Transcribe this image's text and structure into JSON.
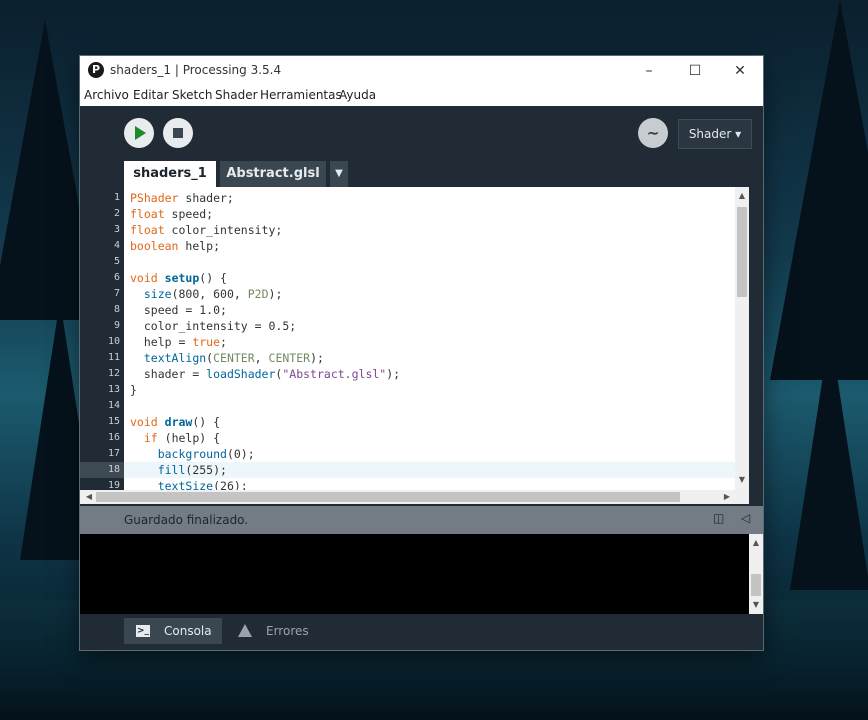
{
  "window": {
    "title": "shaders_1 | Processing 3.5.4",
    "logo_icon": "processing-logo-icon",
    "controls": [
      "minimize-icon",
      "maximize-icon",
      "close-icon"
    ]
  },
  "menu": [
    "Archivo",
    "Editar",
    "Sketch",
    "Shader",
    "Herramientas",
    "Ayuda"
  ],
  "toolbar": {
    "run_icon": "play-icon",
    "stop_icon": "stop-icon",
    "debug_icon": "butterfly-icon",
    "mode": "Shader ▾"
  },
  "tabs": [
    "shaders_1",
    "Abstract.glsl"
  ],
  "tab_menu_glyph": "▼",
  "editor": {
    "line_numbers": [
      "1",
      "2",
      "3",
      "4",
      "5",
      "6",
      "7",
      "8",
      "9",
      "10",
      "11",
      "12",
      "13",
      "14",
      "15",
      "16",
      "17",
      "18",
      "19"
    ],
    "highlighted_line": "18",
    "lines": [
      [
        {
          "t": "PShader",
          "c": "kw"
        },
        {
          "t": " shader;",
          "c": ""
        }
      ],
      [
        {
          "t": "float",
          "c": "kw"
        },
        {
          "t": " speed;",
          "c": ""
        }
      ],
      [
        {
          "t": "float",
          "c": "kw"
        },
        {
          "t": " color_intensity;",
          "c": ""
        }
      ],
      [
        {
          "t": "boolean",
          "c": "kw"
        },
        {
          "t": " help;",
          "c": ""
        }
      ],
      [],
      [
        {
          "t": "void",
          "c": "kw"
        },
        {
          "t": " ",
          "c": ""
        },
        {
          "t": "setup",
          "c": "fnb"
        },
        {
          "t": "() {",
          "c": ""
        }
      ],
      [
        {
          "t": "  ",
          "c": ""
        },
        {
          "t": "size",
          "c": "fn"
        },
        {
          "t": "(800, 600, ",
          "c": ""
        },
        {
          "t": "P2D",
          "c": "cst"
        },
        {
          "t": ");",
          "c": ""
        }
      ],
      [
        {
          "t": "  speed = 1.0;",
          "c": ""
        }
      ],
      [
        {
          "t": "  color_intensity = 0.5;",
          "c": ""
        }
      ],
      [
        {
          "t": "  help = ",
          "c": ""
        },
        {
          "t": "true",
          "c": "kw"
        },
        {
          "t": ";",
          "c": ""
        }
      ],
      [
        {
          "t": "  ",
          "c": ""
        },
        {
          "t": "textAlign",
          "c": "fn"
        },
        {
          "t": "(",
          "c": ""
        },
        {
          "t": "CENTER",
          "c": "cst"
        },
        {
          "t": ", ",
          "c": ""
        },
        {
          "t": "CENTER",
          "c": "cst"
        },
        {
          "t": ");",
          "c": ""
        }
      ],
      [
        {
          "t": "  shader = ",
          "c": ""
        },
        {
          "t": "loadShader",
          "c": "fn"
        },
        {
          "t": "(",
          "c": ""
        },
        {
          "t": "\"Abstract.glsl\"",
          "c": "str"
        },
        {
          "t": ");",
          "c": ""
        }
      ],
      [
        {
          "t": "}",
          "c": ""
        }
      ],
      [],
      [
        {
          "t": "void",
          "c": "kw"
        },
        {
          "t": " ",
          "c": ""
        },
        {
          "t": "draw",
          "c": "fnb"
        },
        {
          "t": "() {",
          "c": ""
        }
      ],
      [
        {
          "t": "  ",
          "c": ""
        },
        {
          "t": "if",
          "c": "kw"
        },
        {
          "t": " (help) {",
          "c": ""
        }
      ],
      [
        {
          "t": "    ",
          "c": ""
        },
        {
          "t": "background",
          "c": "fn"
        },
        {
          "t": "(0);",
          "c": ""
        }
      ],
      [
        {
          "t": "    ",
          "c": ""
        },
        {
          "t": "fill",
          "c": "fn"
        },
        {
          "t": "(255);",
          "c": ""
        }
      ],
      [
        {
          "t": "    ",
          "c": ""
        },
        {
          "t": "textSize",
          "c": "fn"
        },
        {
          "t": "(26);",
          "c": ""
        }
      ]
    ]
  },
  "status": {
    "message": "Guardado finalizado.",
    "copy_icon": "clipboard-icon",
    "collapse_icon": "collapse-arrow-icon"
  },
  "bottom_tabs": {
    "console": "Consola",
    "errors": "Errores"
  },
  "colors": {
    "keyword": "#e2661a",
    "function": "#006699",
    "constant": "#718a62",
    "string": "#7d4793",
    "ide_dark": "#202b35",
    "run_green": "#1a8a2a"
  }
}
